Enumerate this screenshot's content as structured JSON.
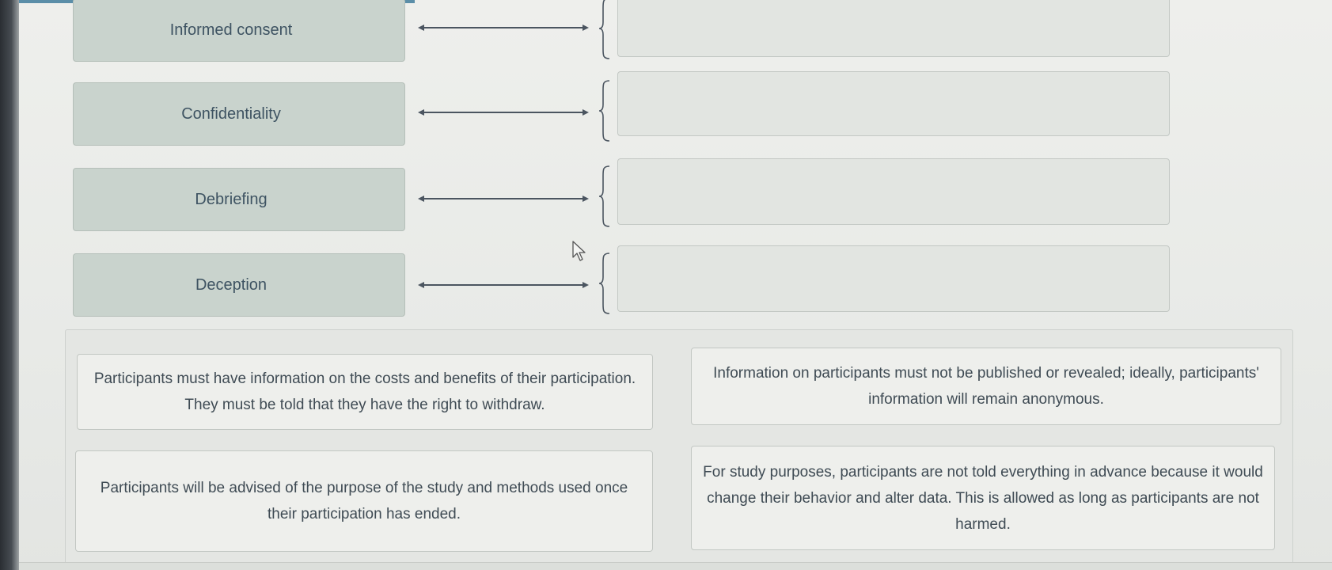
{
  "terms": [
    {
      "label": "Informed consent"
    },
    {
      "label": "Confidentiality"
    },
    {
      "label": "Debriefing"
    },
    {
      "label": "Deception"
    }
  ],
  "answer_cards": [
    {
      "text": "Participants must have information on the costs and benefits of their participation. They must be told that they have the right to withdraw."
    },
    {
      "text": "Information on participants must not be published or revealed; ideally, participants' information will remain anonymous."
    },
    {
      "text": "Participants will be advised of the purpose of the study and methods used once their participation has ended."
    },
    {
      "text": "For study purposes, participants are not told everything in advance because it would change their behavior and alter data. This is allowed as long as participants are not harmed."
    }
  ],
  "colors": {
    "term_bg": "#c9d3cd",
    "drop_bg": "#e2e5e1",
    "card_bg": "#eeefec",
    "text": "#3e5362"
  },
  "icons": [
    "double-arrow-icon",
    "left-brace-icon",
    "mouse-pointer-icon"
  ]
}
